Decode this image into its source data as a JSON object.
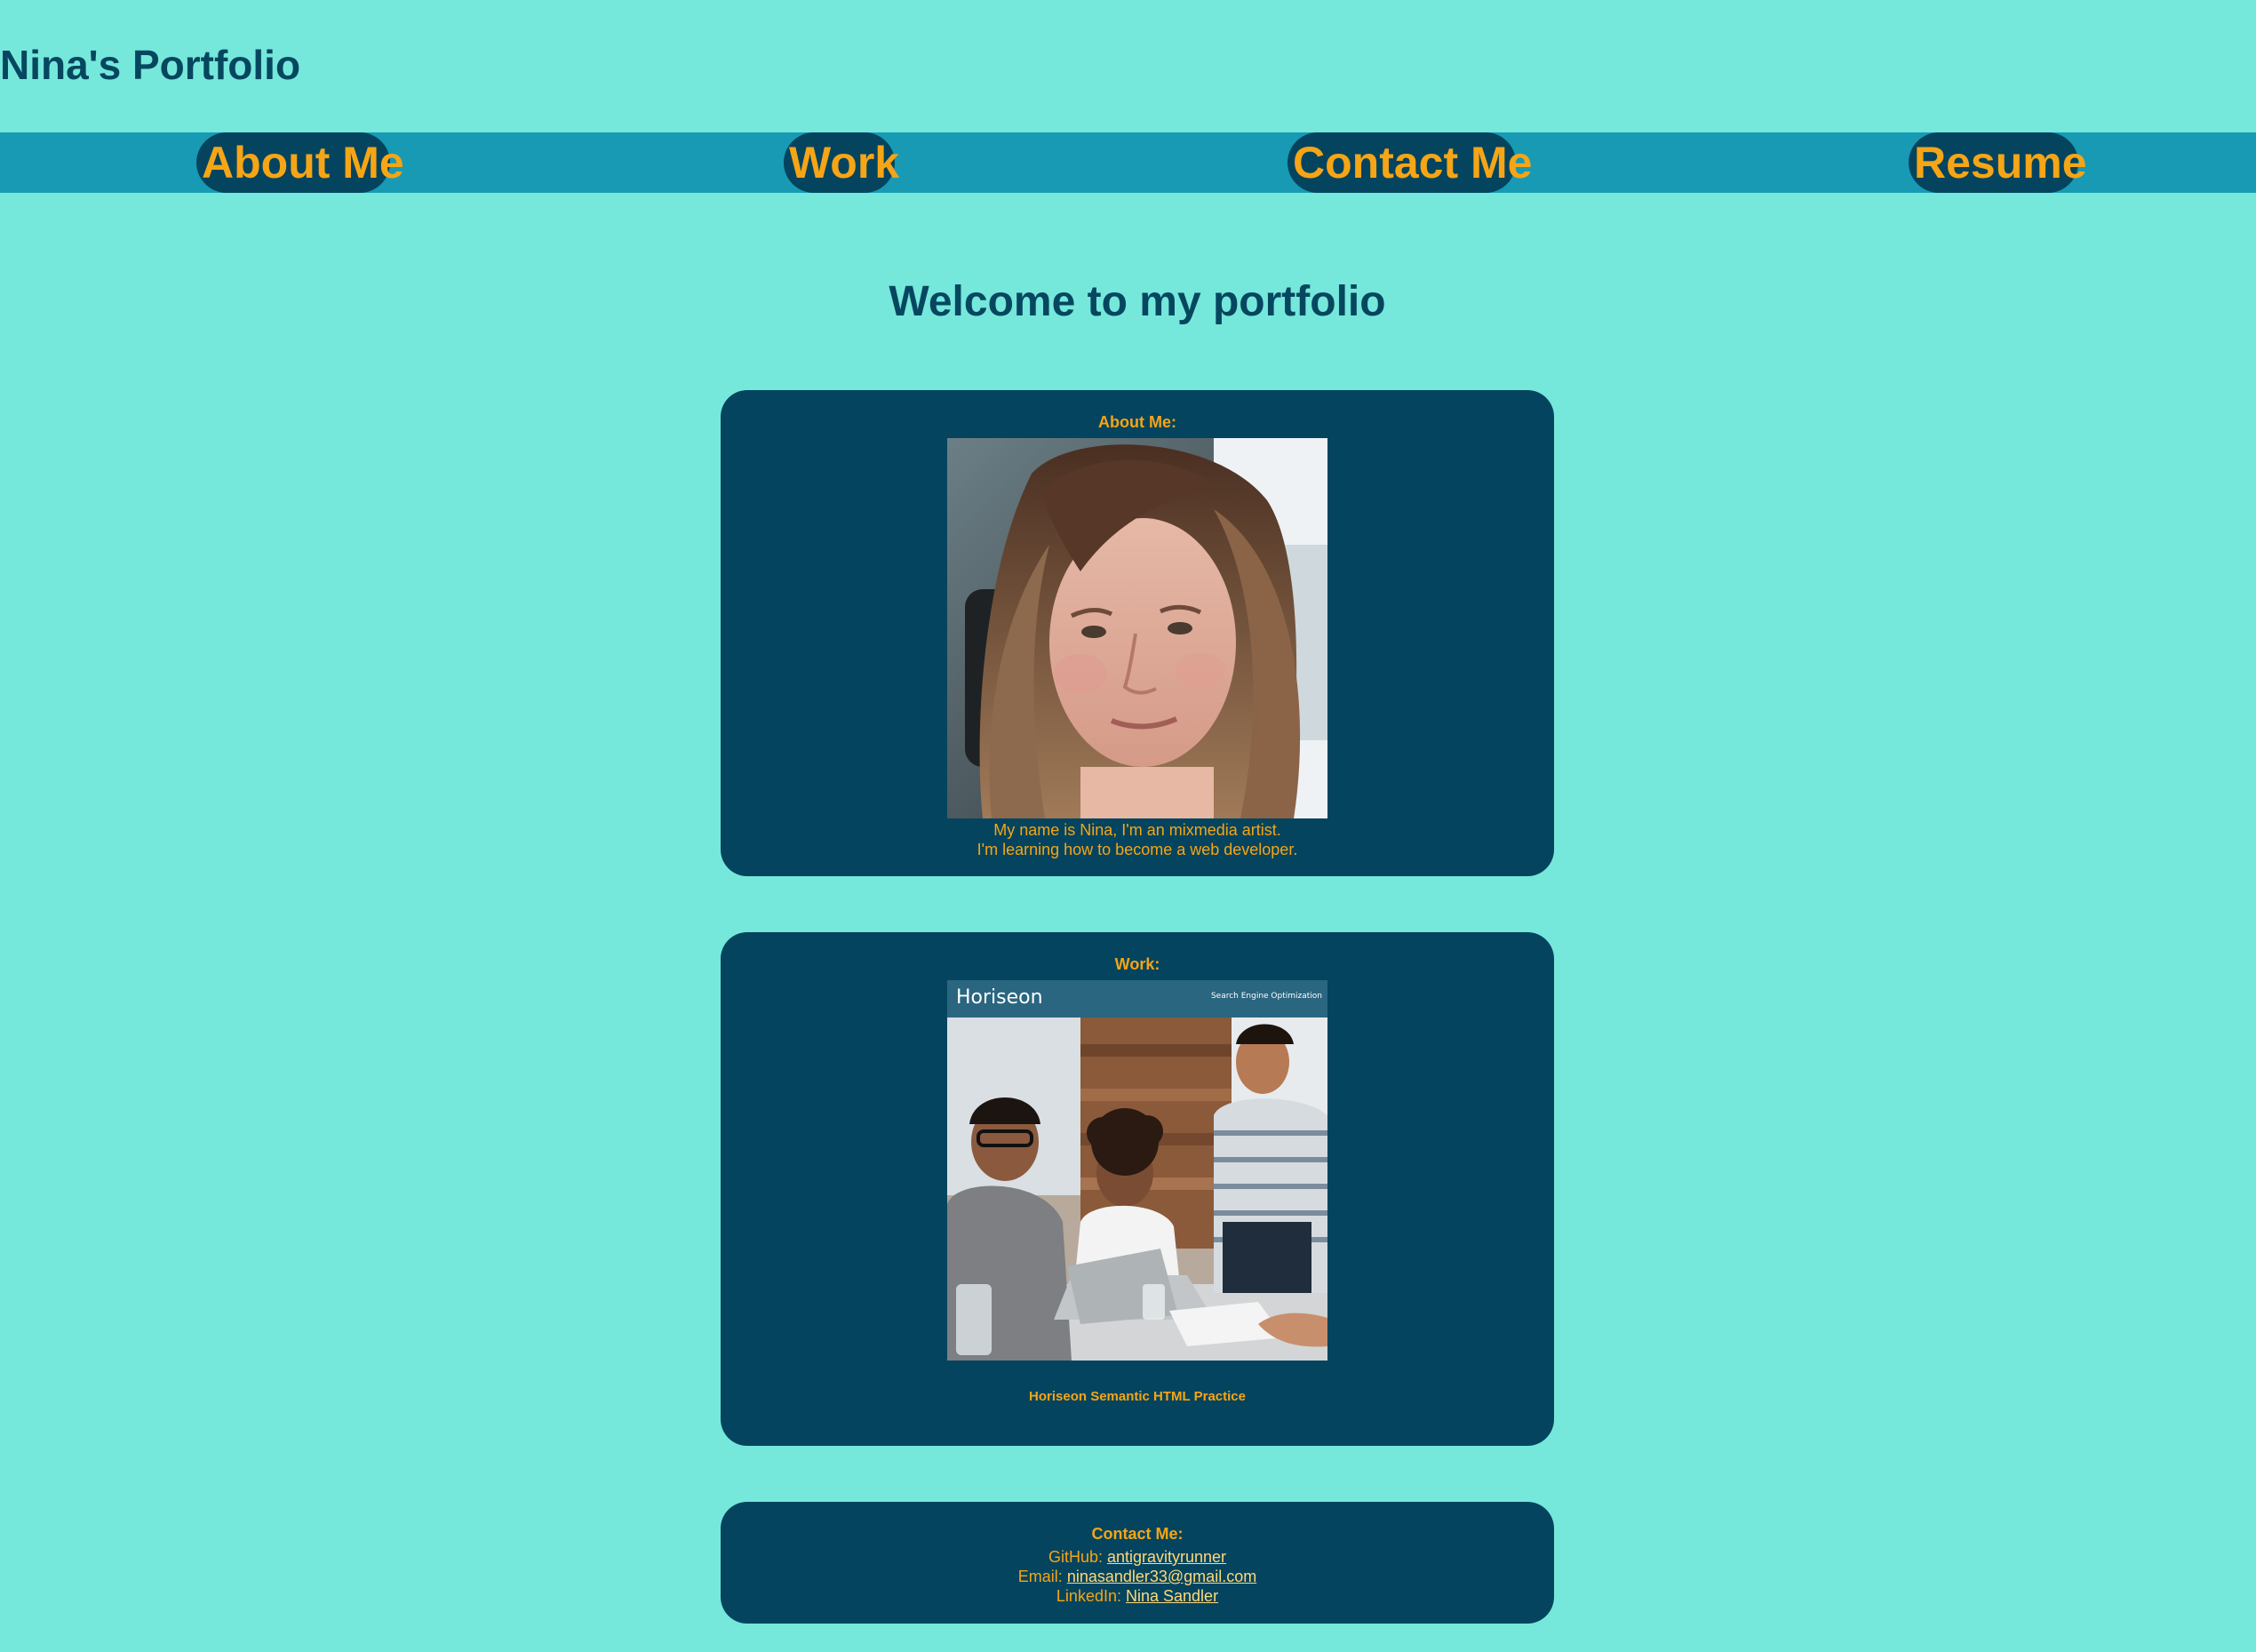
{
  "header": {
    "title": "Nina's Portfolio"
  },
  "nav": {
    "items": [
      {
        "label": "About Me"
      },
      {
        "label": "Work"
      },
      {
        "label": "Contact Me"
      },
      {
        "label": "Resume"
      }
    ]
  },
  "main": {
    "welcome": "Welcome to my portfolio"
  },
  "about": {
    "heading": "About Me:",
    "bio_line1": "My name is Nina, I'm an mixmedia artist.",
    "bio_line2": "I'm learning how to become a web developer."
  },
  "work": {
    "heading": "Work:",
    "preview_brand": "Horiseon",
    "preview_tagline": "Search Engine Optimization",
    "project_title": "Horiseon Semantic HTML Practice"
  },
  "contact": {
    "heading": "Contact Me:",
    "github_label": "GitHub:",
    "github_value": "antigravityrunner",
    "email_label": "Email:",
    "email_value": "ninasandler33@gmail.com",
    "linkedin_label": "LinkedIn:",
    "linkedin_value": "Nina Sandler"
  },
  "colors": {
    "page_bg": "#75e8db",
    "navbar_bg": "#189ab4",
    "dark_navy": "#05445e",
    "accent_orange": "#f5a516"
  }
}
